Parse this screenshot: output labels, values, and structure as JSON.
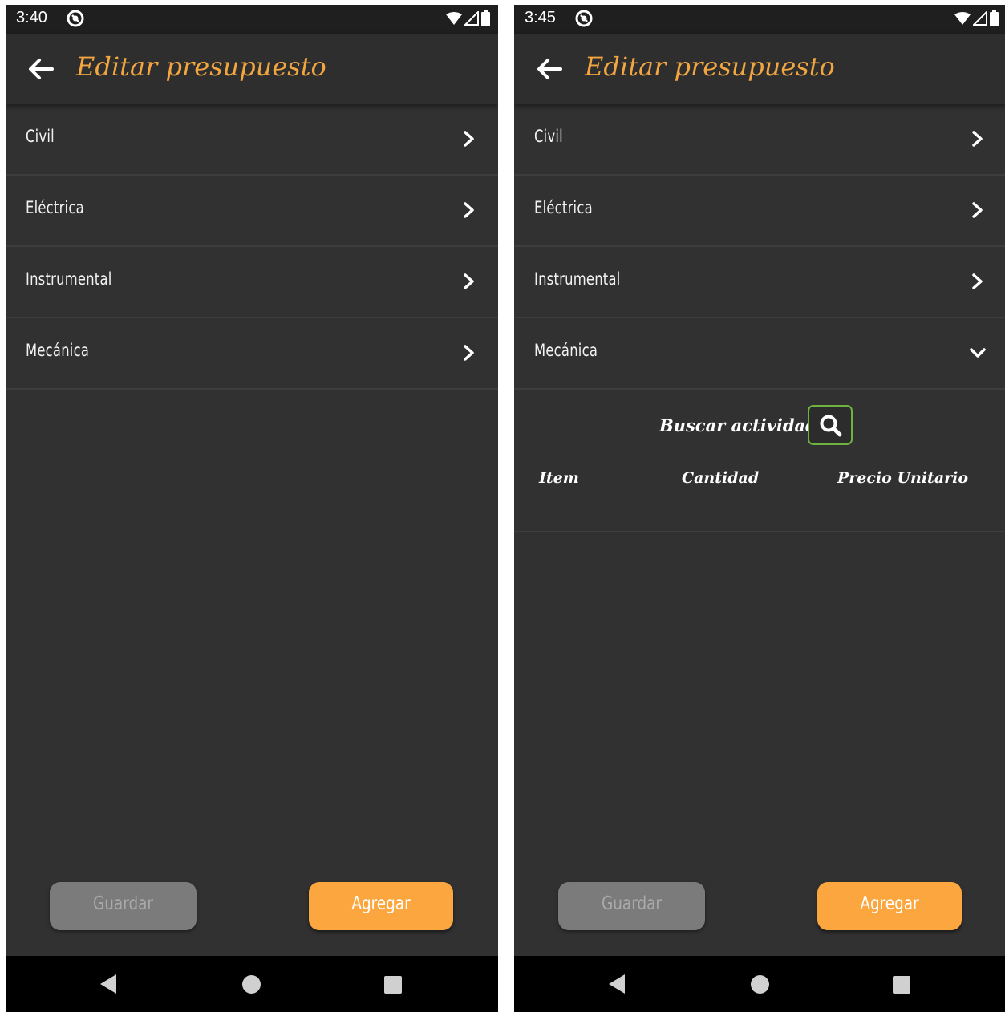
{
  "colors": {
    "accent": "#f3a640",
    "add_button": "#fba63e",
    "save_button": "#7b7b7b",
    "background": "#313131",
    "search_border": "#6db33f"
  },
  "icons": {
    "back": "arrow-left-icon",
    "collapsed": "chevron-right-icon",
    "expanded": "chevron-down-icon",
    "search": "search-icon",
    "status_notification": "notification-icon",
    "wifi": "wifi-icon",
    "signal": "signal-icon",
    "battery": "battery-icon"
  },
  "screens": [
    {
      "status": {
        "time": "3:40"
      },
      "app_bar": {
        "title": "Editar presupuesto"
      },
      "sections": [
        {
          "label": "Civil",
          "expanded": false
        },
        {
          "label": "Eléctrica",
          "expanded": false
        },
        {
          "label": "Instrumental",
          "expanded": false
        },
        {
          "label": "Mecánica",
          "expanded": false
        }
      ],
      "buttons": {
        "save": "Guardar",
        "add": "Agregar"
      }
    },
    {
      "status": {
        "time": "3:45"
      },
      "app_bar": {
        "title": "Editar presupuesto"
      },
      "sections": [
        {
          "label": "Civil",
          "expanded": false
        },
        {
          "label": "Eléctrica",
          "expanded": false
        },
        {
          "label": "Instrumental",
          "expanded": false
        },
        {
          "label": "Mecánica",
          "expanded": true
        }
      ],
      "expanded_panel": {
        "search_label": "Buscar actividad",
        "columns": [
          "Item",
          "Cantidad",
          "Precio Unitario"
        ]
      },
      "buttons": {
        "save": "Guardar",
        "add": "Agregar"
      }
    }
  ]
}
